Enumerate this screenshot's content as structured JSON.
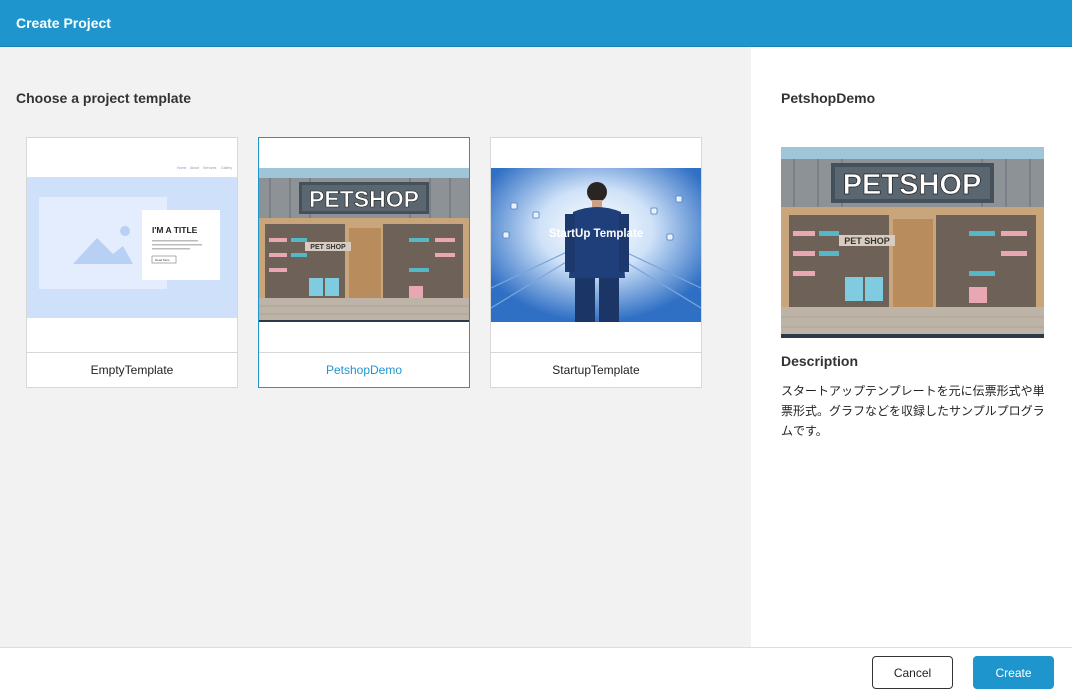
{
  "dialog": {
    "title": "Create Project"
  },
  "templates": {
    "heading": "Choose a project template",
    "items": [
      {
        "name": "EmptyTemplate",
        "selected": false,
        "thumb": {
          "nav": [
            "Home",
            "About",
            "Services",
            "Gallery"
          ],
          "title": "I'M A TITLE",
          "button": "Read More"
        }
      },
      {
        "name": "PetshopDemo",
        "selected": true,
        "thumb": {
          "sign": "PETSHOP",
          "small_sign": "PET SHOP"
        }
      },
      {
        "name": "StartupTemplate",
        "selected": false,
        "thumb": {
          "text": "StartUp Template"
        }
      }
    ]
  },
  "preview": {
    "title": "PetshopDemo",
    "image_sign": "PETSHOP",
    "image_small_sign": "PET SHOP",
    "description_heading": "Description",
    "description": "スタートアップテンプレートを元に伝票形式や単票形式。グラフなどを収録したサンプルプログラムです。"
  },
  "footer": {
    "cancel_label": "Cancel",
    "create_label": "Create"
  },
  "colors": {
    "accent": "#1e96cd",
    "pane_bg": "#f2f2f2"
  }
}
